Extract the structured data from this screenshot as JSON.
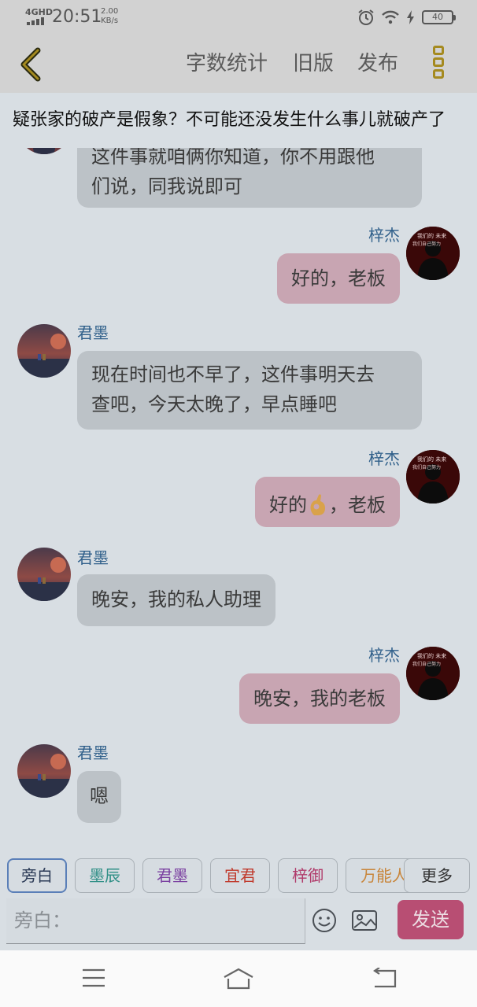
{
  "status_bar": {
    "network": "4GHD",
    "time": "20:51",
    "speed_value": "2.00",
    "speed_unit": "KB/s",
    "battery": "40"
  },
  "title_bar": {
    "back_icon": "chevron-left-icon",
    "menu": [
      "字数统计",
      "旧版",
      "发布"
    ],
    "more_icon": "more-vertical-icon",
    "accent_color": "#a58a1f"
  },
  "chapter_title": "疑张家的破产是假象？不可能还没发生什么事儿就破产了",
  "messages": [
    {
      "side": "left",
      "name": "",
      "lines": [
        "这件事就咱俩你知道，你不用跟他",
        "们说，同我说即可"
      ]
    },
    {
      "side": "right",
      "name": "梓杰",
      "text": "好的，老板"
    },
    {
      "side": "left",
      "name": "君墨",
      "lines": [
        "现在时间也不早了，这件事明天去",
        "查吧，今天太晚了，早点睡吧"
      ]
    },
    {
      "side": "right",
      "name": "梓杰",
      "text_before": "好的",
      "emoji": "ok-hand-emoji",
      "text_after": "，老板"
    },
    {
      "side": "left",
      "name": "君墨",
      "text": "晚安，我的私人助理"
    },
    {
      "side": "right",
      "name": "梓杰",
      "text": "晚安，我的老板"
    },
    {
      "side": "left",
      "name": "君墨",
      "text": "嗯"
    }
  ],
  "avatar_text": {
    "line1": "我们的  未来",
    "line2": "我们自己努力"
  },
  "roles": [
    {
      "label": "旁白",
      "color": "#2b3a56"
    },
    {
      "label": "墨辰",
      "color": "#2f8f86"
    },
    {
      "label": "君墨",
      "color": "#7a3fa0"
    },
    {
      "label": "宜君",
      "color": "#c0392b"
    },
    {
      "label": "梓御",
      "color": "#b03a6a"
    },
    {
      "label": "万能人",
      "color": "#c8853a"
    },
    {
      "label": "更多",
      "color": "#333333"
    }
  ],
  "input": {
    "placeholder": "旁白：",
    "send_label": "发送",
    "send_color": "#b84e73"
  },
  "nav_bar": [
    "menu-icon",
    "home-icon",
    "back-icon"
  ]
}
